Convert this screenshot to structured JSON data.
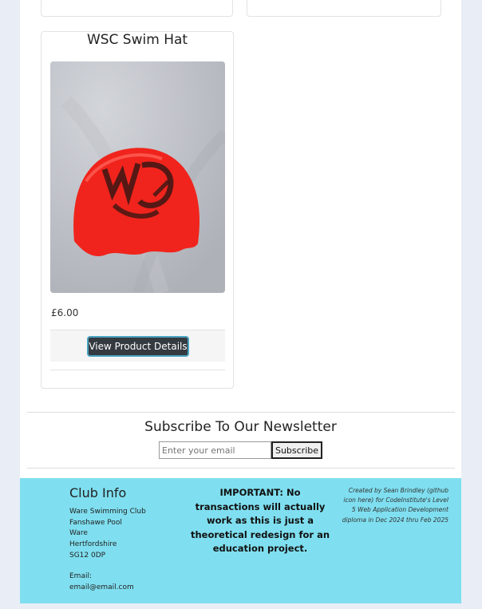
{
  "product": {
    "title": "WSC Swim Hat",
    "price": "£6.00",
    "button_label": "View Product Details"
  },
  "newsletter": {
    "title": "Subscribe To Our Newsletter",
    "email_placeholder": "Enter your email",
    "button_label": "Subscribe"
  },
  "footer": {
    "club_title": "Club Info",
    "club_lines": [
      "Ware Swimming Club",
      "Fanshawe Pool",
      "Ware",
      "Hertfordshire",
      "SG12 0DP"
    ],
    "email_label": "Email:",
    "email_value": "email@email.com",
    "important": "IMPORTANT: No transactions will actually work as this is just a theoretical redesign for an education project.",
    "credit": "Created by Sean Brindley (github icon here) for CodeInstitute's Level 5 Web Application Development diploma in Dec 2024 thru Feb 2025"
  },
  "colors": {
    "footer_bg": "#7fdff0",
    "button_bg": "#343a40",
    "cap_red": "#f0241c"
  }
}
